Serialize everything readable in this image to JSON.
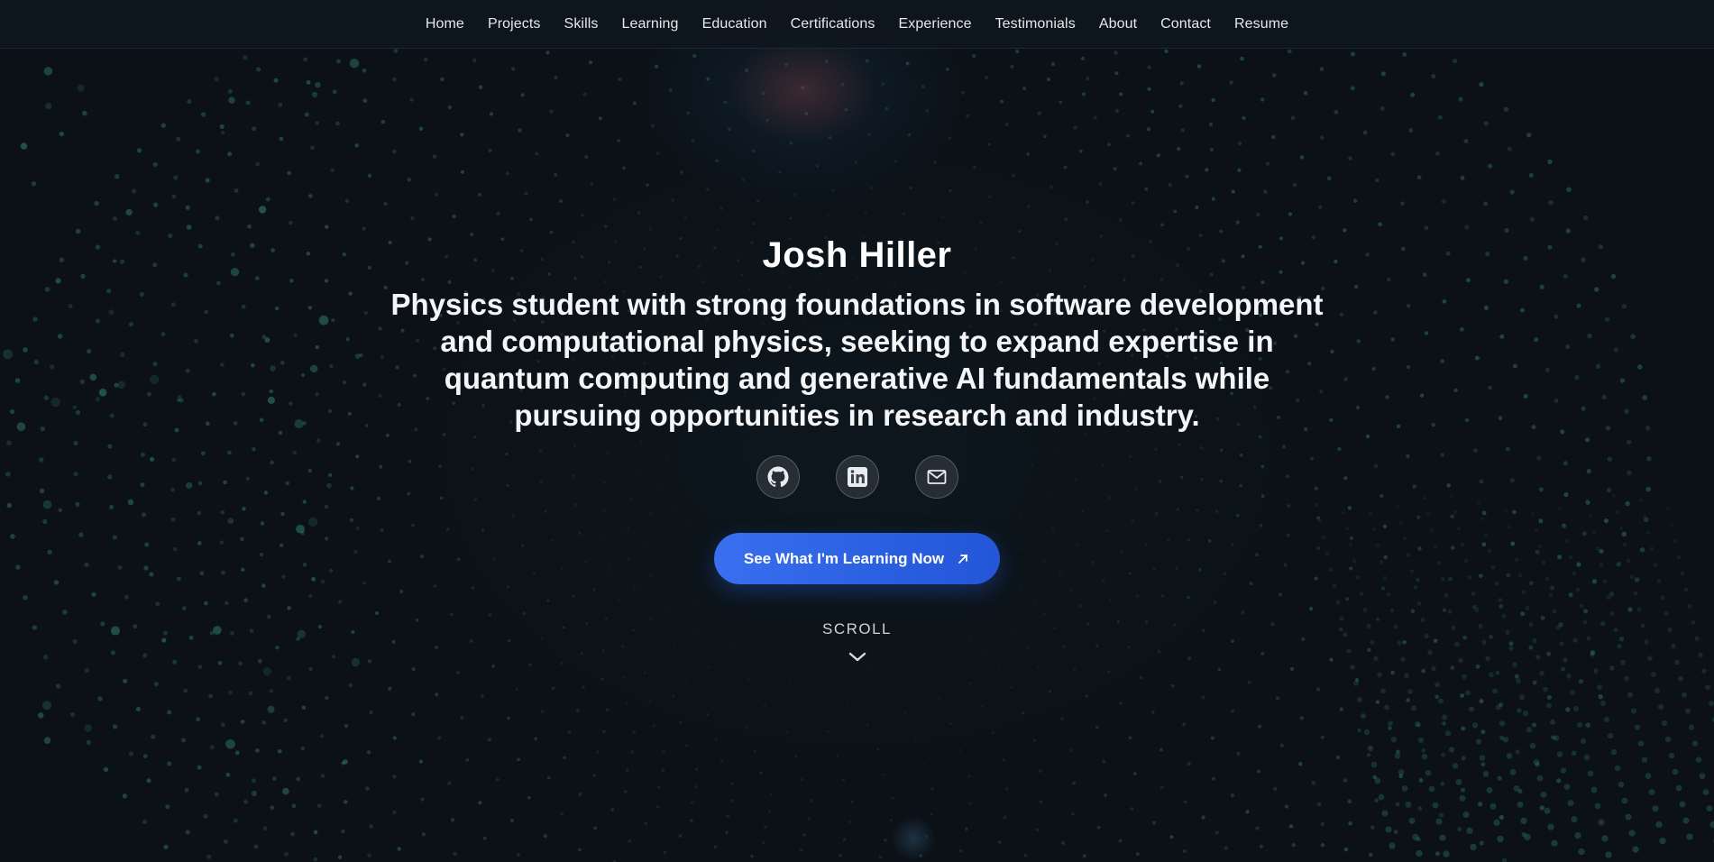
{
  "nav": {
    "items": [
      {
        "label": "Home"
      },
      {
        "label": "Projects"
      },
      {
        "label": "Skills"
      },
      {
        "label": "Learning"
      },
      {
        "label": "Education"
      },
      {
        "label": "Certifications"
      },
      {
        "label": "Experience"
      },
      {
        "label": "Testimonials"
      },
      {
        "label": "About"
      },
      {
        "label": "Contact"
      },
      {
        "label": "Resume"
      }
    ]
  },
  "hero": {
    "name": "Josh Hiller",
    "tagline": "Physics student with strong foundations in software development and computational physics, seeking to expand expertise in quantum computing and generative AI fundamentals while pursuing opportunities in research and industry.",
    "social": [
      {
        "icon": "github-icon"
      },
      {
        "icon": "linkedin-icon"
      },
      {
        "icon": "mail-icon"
      }
    ],
    "cta": {
      "label": "See What I'm Learning Now",
      "icon": "arrow-up-right-icon"
    },
    "scroll_label": "SCROLL"
  },
  "colors": {
    "background": "#0b1117",
    "accent": "#2f66e8",
    "dots": "#3fa08a",
    "text": "#ffffff"
  }
}
